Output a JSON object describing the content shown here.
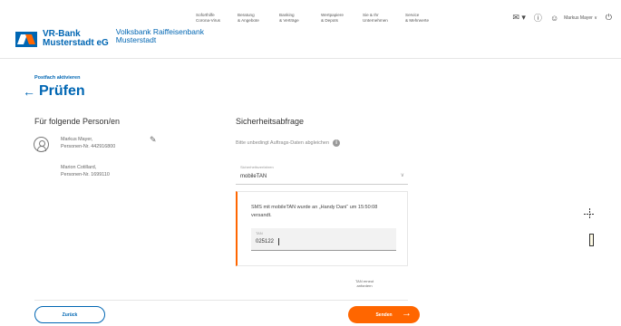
{
  "header": {
    "logo": {
      "bank_line1": "VR-Bank",
      "bank_line2": "Musterstadt eG",
      "sub_line1": "Volksbank Raiffeisenbank",
      "sub_line2": "Musterstadt"
    },
    "nav": [
      {
        "line1": "Soforthilfe",
        "line2": "Corona-Virus"
      },
      {
        "line1": "Beratung",
        "line2": "& Angebote"
      },
      {
        "line1": "Banking",
        "line2": "& Verträge"
      },
      {
        "line1": "Wertpapiere",
        "line2": "& Depots"
      },
      {
        "line1": "Sie & Ihr",
        "line2": "Unternehmen"
      },
      {
        "line1": "Service",
        "line2": "& Mehrwerte"
      }
    ],
    "icons": {
      "mail": "mail-icon",
      "help": "help-icon",
      "user": "user-icon",
      "logout": "logout-icon"
    },
    "user_name": "Markus Mayer ∨"
  },
  "page": {
    "breadcrumb": "Postfach aktivieren",
    "title": "Prüfen"
  },
  "left": {
    "heading": "Für folgende Person/en",
    "persons": [
      {
        "name": "Markus Mayer,",
        "number": "Personen-Nr. 442916800"
      },
      {
        "name": "Marion Cotillard,",
        "number": "Personen-Nr. 1699110"
      }
    ]
  },
  "right": {
    "heading": "Sicherheitsabfrage",
    "compare_text": "Bitte unbedingt Auftrags-Daten abgleichen",
    "method_label": "Sicherheitsverfahren",
    "method_value": "mobileTAN",
    "sms_text": "SMS mit mobileTAN wurde an „Handy Dani“ um 15:50:08 versandt.",
    "tan_label": "TAN",
    "tan_value": "025122",
    "resend_line1": "TAN erneut",
    "resend_line2": "anfordern"
  },
  "buttons": {
    "back": "Zurück",
    "send": "Senden"
  },
  "colors": {
    "brand_blue": "#0066b3",
    "accent_orange": "#ff6600"
  }
}
